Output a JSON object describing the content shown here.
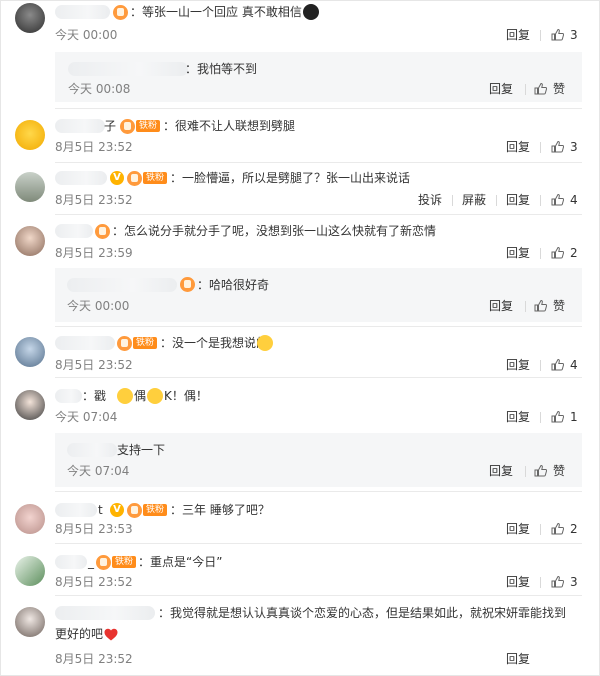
{
  "actions": {
    "reply": "回复",
    "like": "赞",
    "report": "投诉",
    "block": "屏蔽"
  },
  "fan_badge": "铁粉",
  "comments": [
    {
      "text": "：等张一山一个回应 真不敢相信",
      "time": "今天 00:00",
      "likes": "3"
    },
    {
      "text": "：我怕等不到",
      "time": "今天 00:08",
      "like_label": "赞"
    },
    {
      "name_tail": "子",
      "text": "：很难不让人联想到劈腿",
      "time": "8月5日 23:52",
      "likes": "3"
    },
    {
      "text": "：一脸懵逼，所以是劈腿了？张一山出来说话",
      "time": "8月5日 23:52",
      "likes": "4"
    },
    {
      "text": "：怎么说分手就分手了呢，没想到张一山这么快就有了新恋情",
      "time": "8月5日 23:59",
      "likes": "2"
    },
    {
      "text": "：哈哈很好奇",
      "time": "今天 00:00",
      "like_label": "赞"
    },
    {
      "text": "：没一个是我想说的",
      "time": "8月5日 23:52",
      "likes": "4"
    },
    {
      "text_a": "：戳",
      "text_b": "偶",
      "text_c": "K！偶！",
      "time": "今天 07:04",
      "likes": "1"
    },
    {
      "text": "支持一下",
      "time": "今天 07:04",
      "like_label": "赞"
    },
    {
      "name_tail": "t",
      "text": "：三年 睡够了吧？",
      "time": "8月5日 23:53",
      "likes": "2"
    },
    {
      "name_tail": "_",
      "text": "：重点是“今日”",
      "time": "8月5日 23:52",
      "likes": "3"
    },
    {
      "line1": "：我觉得就是想认认真真谈个恋爱的心态，但是结果如此，就祝宋妍霏能找到",
      "line2": "更好的吧",
      "time": "8月5日 23:52"
    }
  ],
  "colors": {
    "fan_badge": "#ff8c1a",
    "time": "#808080",
    "reply_bg": "#f5f6f7",
    "heart": "#e8332f"
  }
}
